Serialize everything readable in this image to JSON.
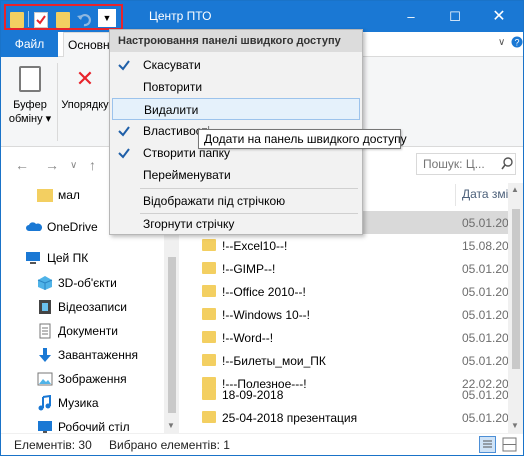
{
  "window": {
    "title": "Центр ПТО",
    "accent_color": "#1a78d4",
    "highlight_color": "#e8232b"
  },
  "ribbon": {
    "tabs": [
      {
        "label": "Файл",
        "active": true
      },
      {
        "label": "Основне"
      }
    ],
    "clipboard_label_line1": "Буфер",
    "clipboard_label_line2": "обміну",
    "organize_label": "Упорядку",
    "collapse_icon": "chevron-down-icon"
  },
  "search": {
    "placeholder": "Пошук: Ц..."
  },
  "navpane": {
    "items": [
      {
        "label": "мал",
        "icon": "folder-icon"
      },
      {
        "label": "OneDrive",
        "icon": "cloud-icon"
      },
      {
        "label": "Цей ПК",
        "icon": "computer-icon"
      },
      {
        "label": "3D-об'єкти",
        "icon": "cube-icon"
      },
      {
        "label": "Відеозаписи",
        "icon": "video-icon"
      },
      {
        "label": "Документи",
        "icon": "document-icon"
      },
      {
        "label": "Завантаження",
        "icon": "download-icon"
      },
      {
        "label": "Зображення",
        "icon": "image-icon"
      },
      {
        "label": "Музика",
        "icon": "music-icon"
      },
      {
        "label": "Робочий стіл",
        "icon": "desktop-icon"
      }
    ]
  },
  "filelist": {
    "date_header": "Дата змі",
    "rows": [
      {
        "name": "",
        "date": "05.01.201",
        "selected": true
      },
      {
        "name": "!--Excel10--!",
        "date": "15.08.201"
      },
      {
        "name": "!--GIMP--!",
        "date": "05.01.201"
      },
      {
        "name": "!--Office 2010--!",
        "date": "05.01.201"
      },
      {
        "name": "!--Windows 10--!",
        "date": "05.01.201"
      },
      {
        "name": "!--Word--!",
        "date": "05.01.201"
      },
      {
        "name": "!--Билеты_мои_ПК",
        "date": "05.01.201"
      },
      {
        "name": "!---Полезное---!",
        "date": "22.02.201"
      },
      {
        "name": "18-09-2018",
        "date": "05.01.201"
      },
      {
        "name": "25-04-2018 презентация",
        "date": "05.01.201"
      }
    ]
  },
  "statusbar": {
    "items_count": "Елементів: 30",
    "selected_count": "Вибрано елементів: 1"
  },
  "qat_menu": {
    "title": "Настроювання панелі швидкого доступу",
    "items": [
      {
        "label": "Скасувати",
        "checked": true
      },
      {
        "label": "Повторити",
        "checked": false
      },
      {
        "label": "Видалити",
        "checked": false,
        "hover": true
      },
      {
        "label": "Властивості",
        "checked": true
      },
      {
        "label": "Створити папку",
        "checked": true
      },
      {
        "label": "Перейменувати",
        "checked": false
      },
      {
        "label": "Відображати під стрічкою",
        "checked": false
      },
      {
        "label": "Згорнути стрічку",
        "checked": false
      }
    ]
  },
  "tooltip": {
    "text": "Додати на панель швидкого доступу"
  }
}
